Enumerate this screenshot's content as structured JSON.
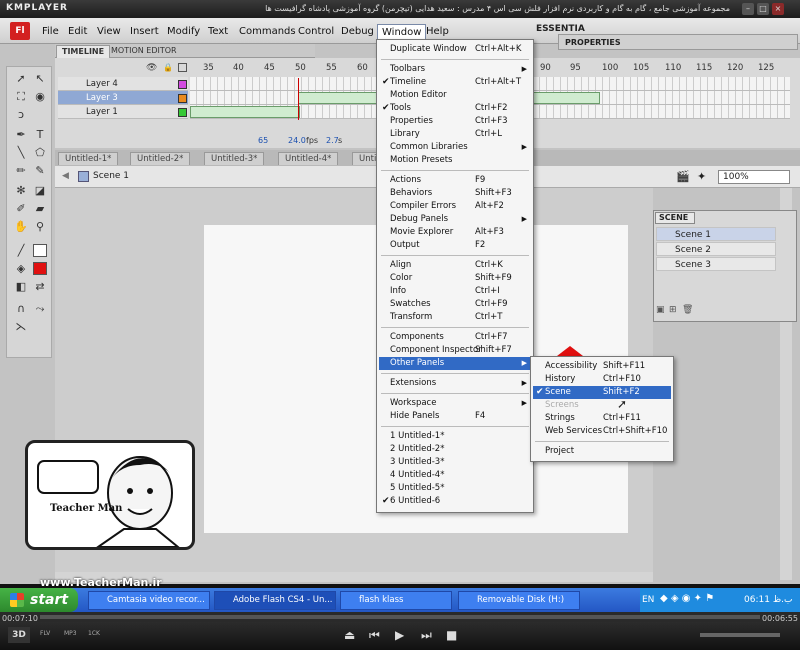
{
  "player": {
    "logo": "KMPLAYER",
    "title": "مجموعه آموزشی جامع ، گام به گام و کاربردی نرم افزار فلش سی اس ۴ مدرس : سعید هدایی (تیچرمن) گروه آموزشی پادشاه گرافیست ها",
    "time_elapsed": "00:07:10",
    "time_total": "00:06:55",
    "badges": [
      "3D",
      "FLV",
      "MP3",
      "1CK"
    ]
  },
  "app": {
    "logo": "Fl",
    "menus": [
      "File",
      "Edit",
      "View",
      "Insert",
      "Modify",
      "Text",
      "Commands",
      "Control",
      "Debug",
      "Window",
      "Help"
    ],
    "active_menu": "Window",
    "workspace": "ESSENTIA"
  },
  "timeline": {
    "tabs": [
      "TIMELINE",
      "MOTION EDITOR"
    ],
    "ruler": [
      "35",
      "40",
      "45",
      "50",
      "55",
      "60",
      "65",
      "70",
      "75",
      "80",
      "85",
      "90",
      "95",
      "100",
      "105",
      "110",
      "115",
      "120",
      "125"
    ],
    "layers": [
      {
        "name": "Layer 4",
        "color": "#d24ae0"
      },
      {
        "name": "Layer 3",
        "color": "#e98a1e"
      },
      {
        "name": "Layer 1",
        "color": "#37c837"
      }
    ],
    "frame": "65",
    "fps": "24.0",
    "fps_unit": "fps",
    "time": "2.7",
    "time_unit": "s"
  },
  "doc_tabs": [
    "Untitled-1*",
    "Untitled-2*",
    "Untitled-3*",
    "Untitled-4*",
    "Untitled-5*"
  ],
  "scene_label": "Scene 1",
  "zoom": "100%",
  "panels": {
    "properties": "PROPERTIES",
    "scene": {
      "title": "SCENE",
      "items": [
        "Scene 1",
        "Scene 2",
        "Scene 3"
      ]
    }
  },
  "window_menu": {
    "groups": [
      [
        {
          "label": "Duplicate Window",
          "shortcut": "Ctrl+Alt+K"
        }
      ],
      [
        {
          "label": "Toolbars",
          "submenu": true
        },
        {
          "label": "Timeline",
          "shortcut": "Ctrl+Alt+T",
          "checked": true
        },
        {
          "label": "Motion Editor"
        },
        {
          "label": "Tools",
          "shortcut": "Ctrl+F2",
          "checked": true
        },
        {
          "label": "Properties",
          "shortcut": "Ctrl+F3"
        },
        {
          "label": "Library",
          "shortcut": "Ctrl+L"
        },
        {
          "label": "Common Libraries",
          "submenu": true
        },
        {
          "label": "Motion Presets"
        }
      ],
      [
        {
          "label": "Actions",
          "shortcut": "F9"
        },
        {
          "label": "Behaviors",
          "shortcut": "Shift+F3"
        },
        {
          "label": "Compiler Errors",
          "shortcut": "Alt+F2"
        },
        {
          "label": "Debug Panels",
          "submenu": true
        },
        {
          "label": "Movie Explorer",
          "shortcut": "Alt+F3"
        },
        {
          "label": "Output",
          "shortcut": "F2"
        }
      ],
      [
        {
          "label": "Align",
          "shortcut": "Ctrl+K"
        },
        {
          "label": "Color",
          "shortcut": "Shift+F9"
        },
        {
          "label": "Info",
          "shortcut": "Ctrl+I"
        },
        {
          "label": "Swatches",
          "shortcut": "Ctrl+F9"
        },
        {
          "label": "Transform",
          "shortcut": "Ctrl+T"
        }
      ],
      [
        {
          "label": "Components",
          "shortcut": "Ctrl+F7"
        },
        {
          "label": "Component Inspector",
          "shortcut": "Shift+F7"
        },
        {
          "label": "Other Panels",
          "submenu": true,
          "highlighted": true
        }
      ],
      [
        {
          "label": "Extensions",
          "submenu": true
        }
      ],
      [
        {
          "label": "Workspace",
          "submenu": true
        },
        {
          "label": "Hide Panels",
          "shortcut": "F4"
        }
      ],
      [
        {
          "label": "1 Untitled-1*"
        },
        {
          "label": "2 Untitled-2*"
        },
        {
          "label": "3 Untitled-3*"
        },
        {
          "label": "4 Untitled-4*"
        },
        {
          "label": "5 Untitled-5*"
        },
        {
          "label": "6 Untitled-6",
          "checked": true
        }
      ]
    ]
  },
  "other_panels_menu": {
    "items": [
      {
        "label": "Accessibility",
        "shortcut": "Shift+F11"
      },
      {
        "label": "History",
        "shortcut": "Ctrl+F10"
      },
      {
        "label": "Scene",
        "shortcut": "Shift+F2",
        "checked": true,
        "highlighted": true
      },
      {
        "label": "Screens",
        "disabled": true
      },
      {
        "label": "Strings",
        "shortcut": "Ctrl+F11"
      },
      {
        "label": "Web Services",
        "shortcut": "Ctrl+Shift+F10"
      },
      {
        "label": "Project",
        "separator_before": true
      }
    ]
  },
  "branding": {
    "name": "Teacher Man",
    "site": "www.TeacherMan.ir"
  },
  "taskbar": {
    "start": "start",
    "tasks": [
      "Camtasia video recor...",
      "Adobe Flash CS4 - Un...",
      "flash klass",
      "Removable Disk (H:)"
    ],
    "lang": "EN",
    "clock": "06:11 ب.ظ"
  }
}
